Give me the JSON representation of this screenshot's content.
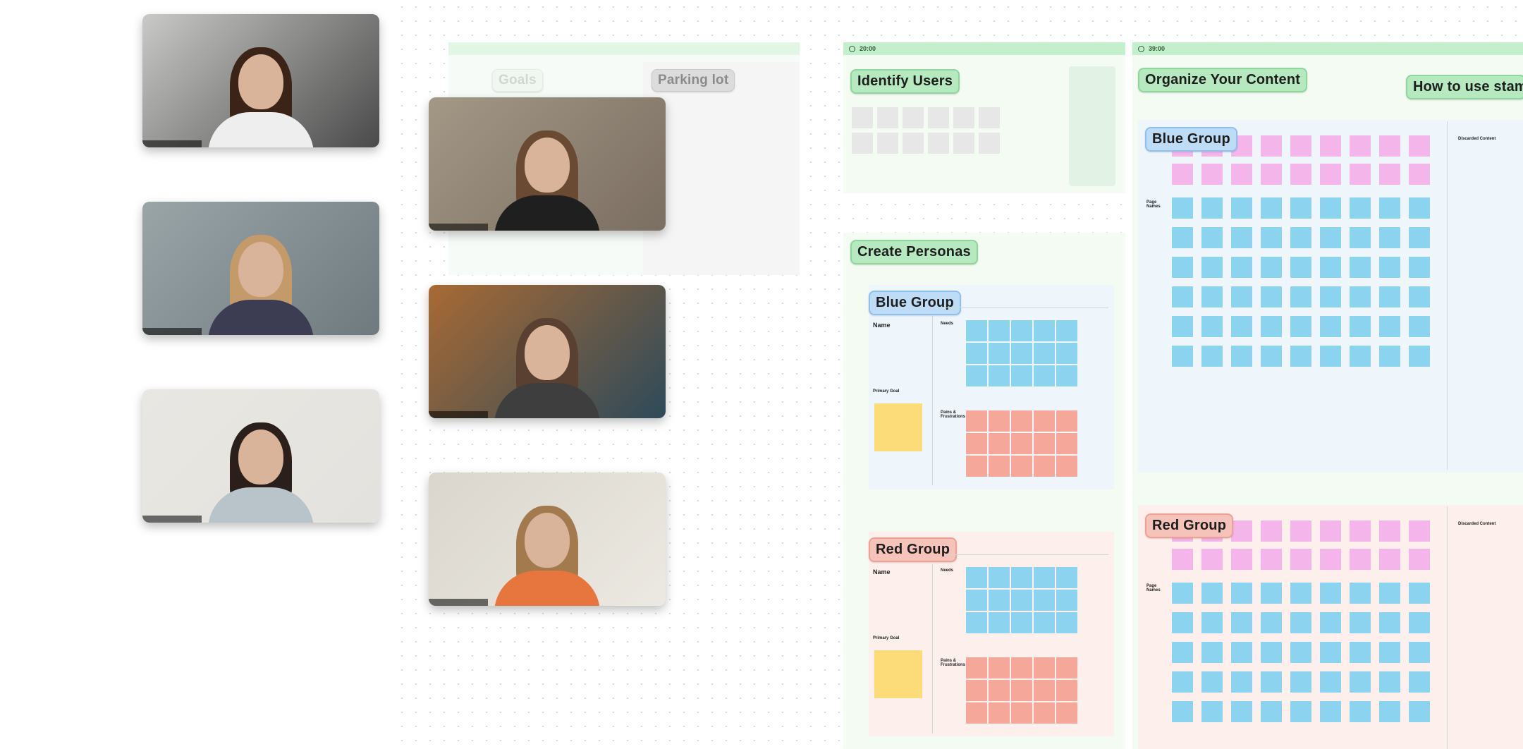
{
  "participants": [
    {
      "id": "p1",
      "bg": "#4a4a4a",
      "wall": "#c9c9c7",
      "hair": "#3b2318",
      "shirt": "#eeeeee"
    },
    {
      "id": "p2",
      "bg": "#6f7a7f",
      "wall": "#9aa5a8",
      "hair": "#c49a6a",
      "shirt": "#3c3c52"
    },
    {
      "id": "p3",
      "bg": "#e4e2de",
      "wall": "#e9e7e2",
      "hair": "#2a1f1a",
      "shirt": "#b9c3ca"
    },
    {
      "id": "p4",
      "bg": "#7b6e62",
      "wall": "#a39886",
      "hair": "#6a4a32",
      "shirt": "#1f1f1f"
    },
    {
      "id": "p5",
      "bg": "#2e4a5a",
      "wall": "#a86a34",
      "hair": "#5a4030",
      "shirt": "#3e3e3e"
    },
    {
      "id": "p6",
      "bg": "#ece9e2",
      "wall": "#dad6cd",
      "hair": "#a27a4e",
      "shirt": "#e7763e"
    }
  ],
  "board": {
    "goals_label": "Goals",
    "parking_lot_label": "Parking lot",
    "identify_users": {
      "timer": "20:00",
      "title": "Identify Users"
    },
    "create_personas": {
      "title": "Create Personas",
      "blue_group": "Blue Group",
      "red_group": "Red Group",
      "name_label": "Name",
      "needs_label": "Needs",
      "pains_label": "Pains & Frustrations",
      "primary_goal_label": "Primary Goal"
    },
    "organize_content": {
      "timer": "39:00",
      "title": "Organize Your Content",
      "blue_group": "Blue Group",
      "red_group": "Red Group",
      "discarded_label": "Discarded Content",
      "page_names_label": "Page Names"
    },
    "how_to_use_label": "How to use stam..."
  },
  "colors": {
    "frame_green": "#c4efcc",
    "sticky_cyan": "#8bd3ef",
    "sticky_pink": "#f4b6ea",
    "sticky_salmon": "#f5a799",
    "sticky_yellow": "#fbdc78"
  }
}
